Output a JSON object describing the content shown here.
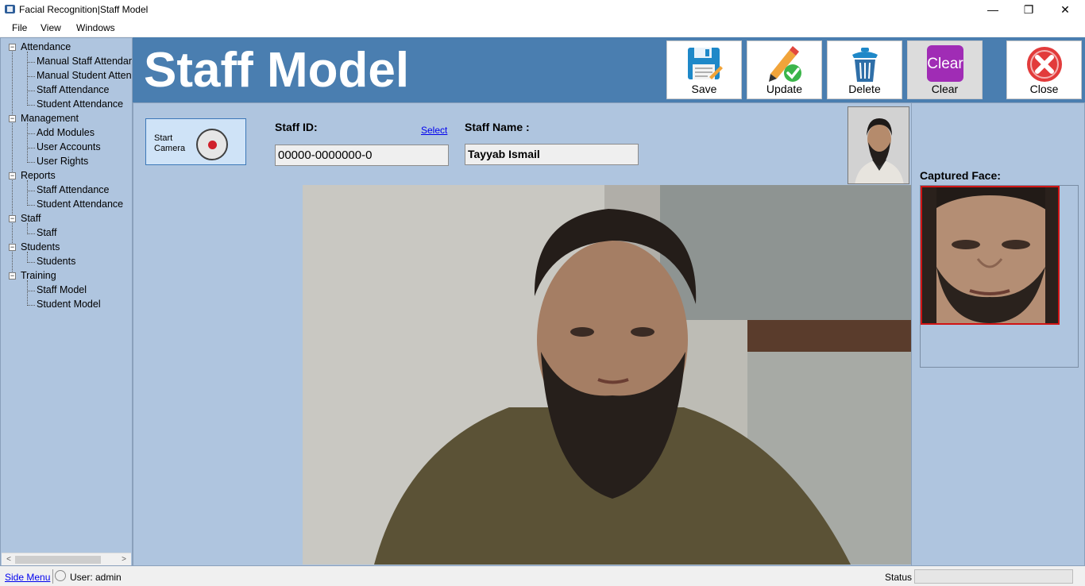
{
  "window": {
    "title": "Facial Recognition|Staff Model",
    "minimize_glyph": "—",
    "maximize_glyph": "❐",
    "close_glyph": "✕"
  },
  "menu": {
    "file": "File",
    "view": "View",
    "windows": "Windows"
  },
  "side_menu": {
    "groups": [
      {
        "label": "Attendance",
        "items": [
          "Manual Staff Attendan",
          "Manual Student Attend",
          "Staff Attendance",
          "Student Attendance"
        ]
      },
      {
        "label": "Management",
        "items": [
          "Add Modules",
          "User Accounts",
          "User Rights"
        ]
      },
      {
        "label": "Reports",
        "items": [
          "Staff Attendance",
          "Student Attendance"
        ]
      },
      {
        "label": "Staff",
        "items": [
          "Staff"
        ]
      },
      {
        "label": "Students",
        "items": [
          "Students"
        ]
      },
      {
        "label": "Training",
        "items": [
          "Staff Model",
          "Student Model"
        ]
      }
    ],
    "scroll_left": "<",
    "scroll_right": ">"
  },
  "header": {
    "title": "Staff Model",
    "toolbar": {
      "save": "Save",
      "update": "Update",
      "delete": "Delete",
      "clear": "Clear",
      "close": "Close",
      "clear_icon_text": "Clear"
    }
  },
  "form": {
    "start_camera_line1": "Start",
    "start_camera_line2": "Camera",
    "staff_id_label": "Staff ID:",
    "select_link": "Select",
    "staff_id_value": "00000-0000000-0",
    "staff_name_label": "Staff Name :",
    "staff_name_value": "Tayyab Ismail",
    "captured_face_label": "Captured Face:"
  },
  "statusbar": {
    "side_menu_link": "Side Menu",
    "user_label": "User:",
    "user_value": "admin",
    "status_label": "Status"
  },
  "colors": {
    "header_bg": "#4a7eb0",
    "panel_bg": "#afc5df",
    "accent_red": "#d01414",
    "link": "#0000ee"
  }
}
